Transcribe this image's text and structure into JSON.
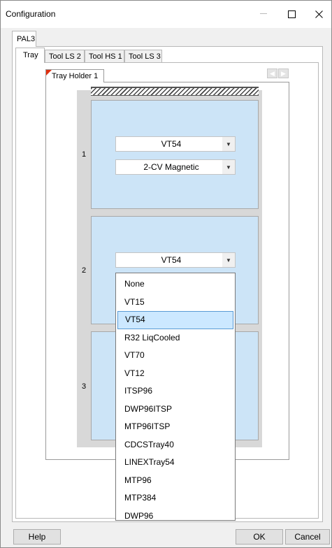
{
  "window": {
    "title": "Configuration"
  },
  "outer_tabs": [
    "PAL3"
  ],
  "inner_tabs": [
    "Tray",
    "Tool LS 2",
    "Tool HS 1",
    "Tool LS 3"
  ],
  "holder_tab": "Tray Holder 1",
  "slots": [
    {
      "number": "1",
      "tray": "VT54",
      "magnet": "2-CV Magnetic"
    },
    {
      "number": "2",
      "tray": "VT54"
    },
    {
      "number": "3"
    }
  ],
  "dropdown": {
    "options": [
      "None",
      "VT15",
      "VT54",
      "R32 LiqCooled",
      "VT70",
      "VT12",
      "ITSP96",
      "DWP96ITSP",
      "MTP96ITSP",
      "CDCSTray40",
      "LINEXTray54",
      "MTP96",
      "MTP384",
      "DWP96"
    ],
    "selected": "VT54"
  },
  "buttons": {
    "help": "Help",
    "ok": "OK",
    "cancel": "Cancel"
  },
  "icons": {
    "minimize": "minimize-icon",
    "maximize": "maximize-icon",
    "close": "close-icon",
    "dropdown": "chevron-down-icon"
  },
  "colors": {
    "slot_bg": "#cce4f7",
    "selection": "#cce8ff",
    "corner_marker": "#e03010"
  }
}
